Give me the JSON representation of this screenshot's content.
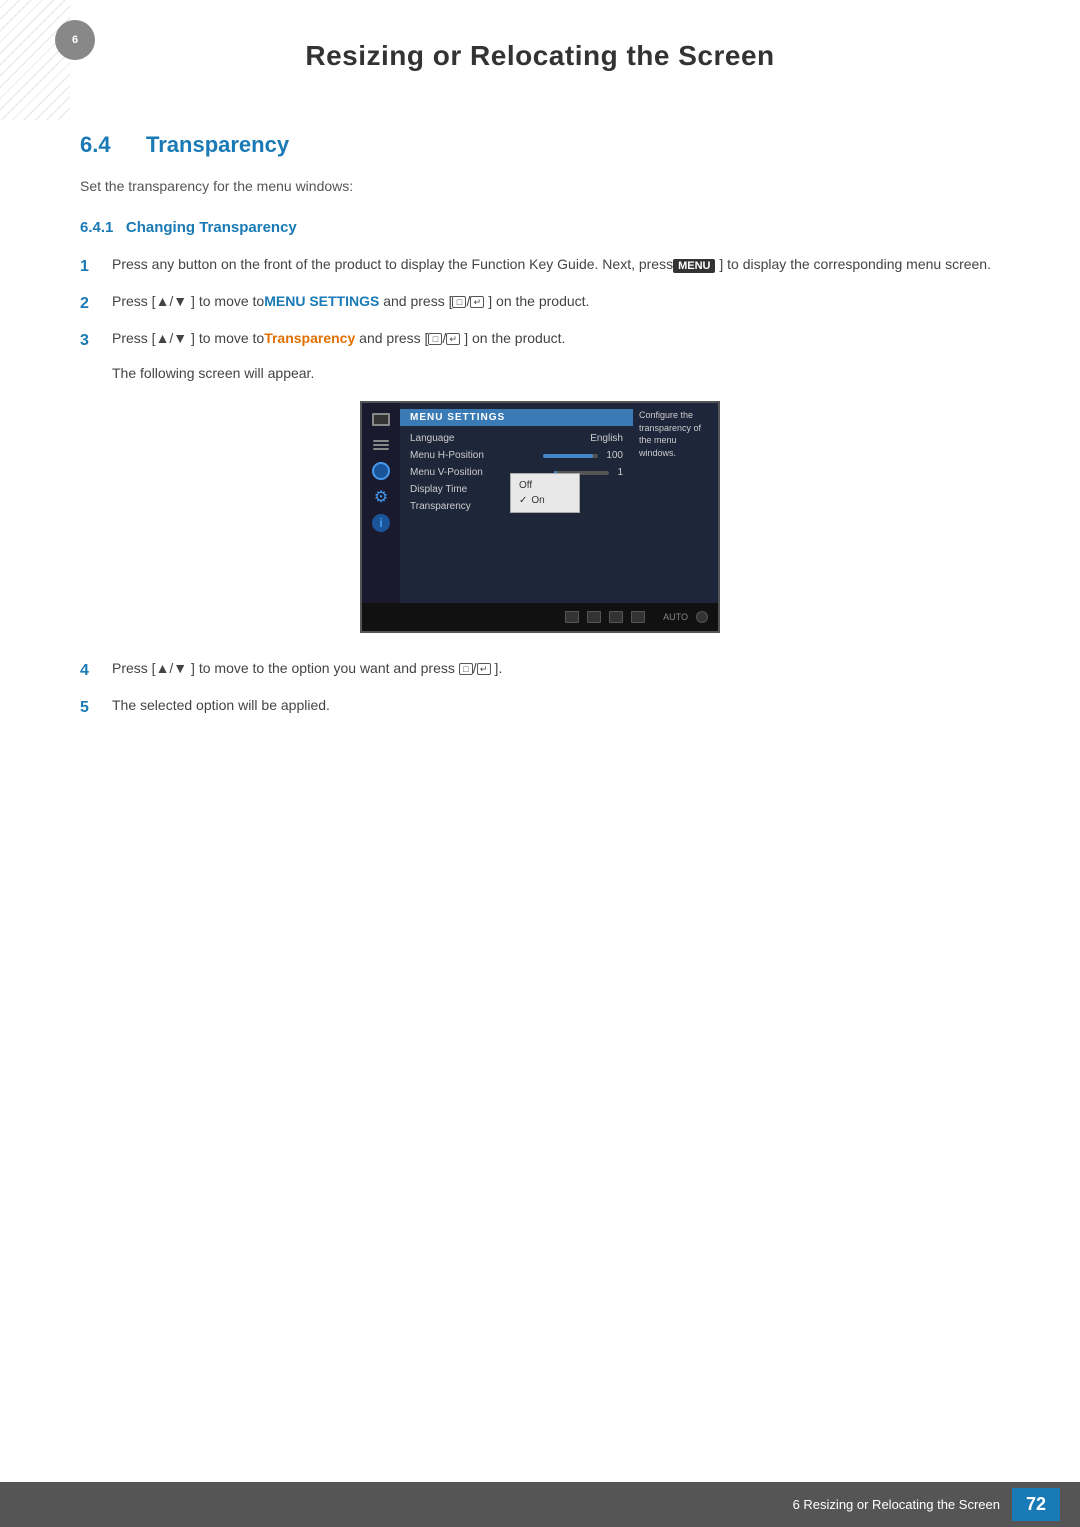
{
  "page": {
    "title": "Resizing or Relocating the Screen",
    "chapter_marker": "6",
    "background_stripe": true
  },
  "section": {
    "number": "6.4",
    "title": "Transparency",
    "description": "Set the transparency for the menu windows:"
  },
  "subsection": {
    "number": "6.4.1",
    "title": "Changing Transparency"
  },
  "steps": [
    {
      "number": "1",
      "text": "Press any button on the front of the product to display the Function Key Guide. Next, press",
      "key": "MENU",
      "text2": "] to display the corresponding menu screen."
    },
    {
      "number": "2",
      "text": "Press [▲/▼ ] to move to",
      "highlight": "MENU SETTINGS",
      "text2": "and press [□/↵ ] on the product."
    },
    {
      "number": "3",
      "text": "Press [▲/▼ ] to move to",
      "highlight": "Transparency",
      "text2": "and press [□/↵ ] on the product.",
      "note": "The following screen will appear."
    },
    {
      "number": "4",
      "text": "Press [▲/▼ ] to move to the option you want and press □/↵ ]."
    },
    {
      "number": "5",
      "text": "The selected option will be applied."
    }
  ],
  "monitor_screen": {
    "menu_header": "MENU SETTINGS",
    "menu_items": [
      {
        "label": "Language",
        "value": "English",
        "type": "text"
      },
      {
        "label": "Menu H-Position",
        "value": "100",
        "type": "slider",
        "fill_pct": 90
      },
      {
        "label": "Menu V-Position",
        "value": "1",
        "type": "slider",
        "fill_pct": 5
      },
      {
        "label": "Display Time",
        "value": "",
        "type": "text"
      },
      {
        "label": "Transparency",
        "value": "",
        "type": "text"
      }
    ],
    "dropdown": {
      "items": [
        "Off",
        "On"
      ],
      "selected": "On"
    },
    "tooltip": "Configure the transparency of the menu windows.",
    "bottom_buttons": [
      "◄",
      "▼",
      "▲",
      "↵",
      "AUTO",
      "⏻"
    ]
  },
  "footer": {
    "text": "6 Resizing or Relocating the Screen",
    "page_number": "72"
  }
}
